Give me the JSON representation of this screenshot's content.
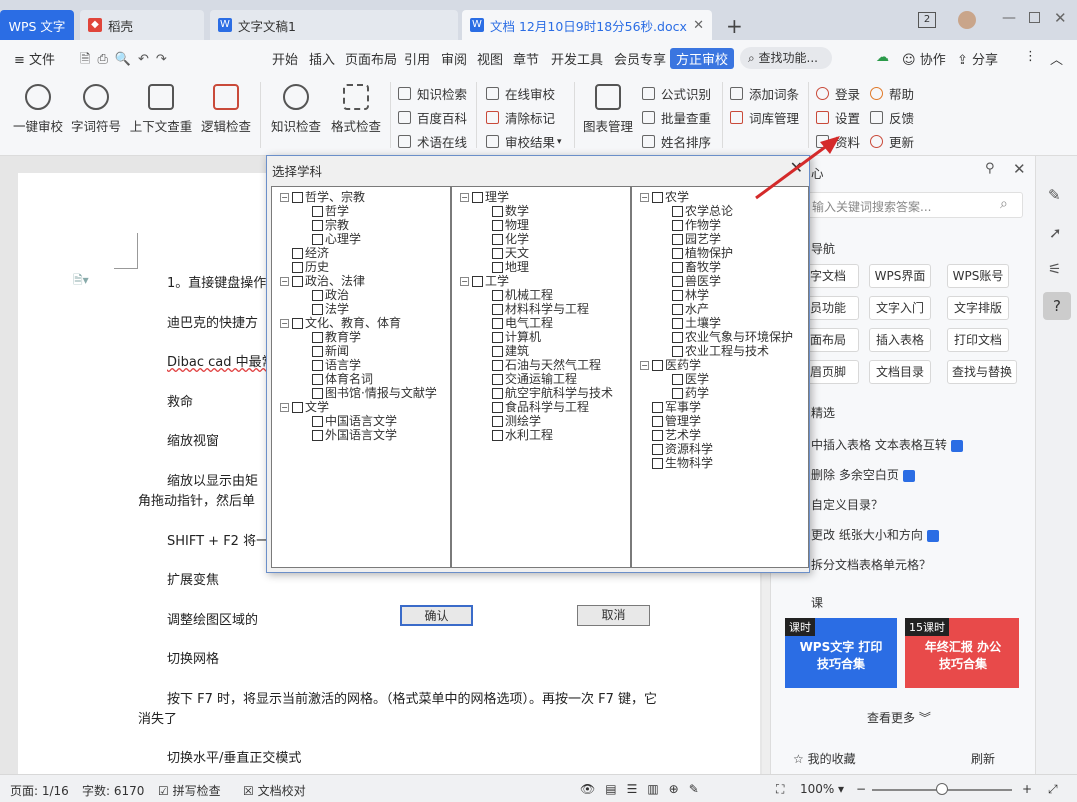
{
  "tabs": [
    {
      "label": "WPS 文字"
    },
    {
      "label": "稻壳"
    },
    {
      "label": "文字文稿1"
    },
    {
      "label": "文档 12月10日9时18分56秒.docx"
    }
  ],
  "window": {
    "badge": "2"
  },
  "menu": {
    "file": "文件",
    "items": [
      "开始",
      "插入",
      "页面布局",
      "引用",
      "审阅",
      "视图",
      "章节",
      "开发工具",
      "会员专享"
    ],
    "active": "方正审校",
    "search": "查找功能...",
    "collab": "协作",
    "share": "分享"
  },
  "ribbon": {
    "big": [
      "一键审校",
      "字词符号",
      "上下文查重",
      "逻辑检查",
      "知识检查",
      "格式检查",
      "图表管理"
    ],
    "small": {
      "g1": [
        "知识检索",
        "百度百科",
        "术语在线"
      ],
      "g2": [
        "在线审校",
        "清除标记",
        "审校结果"
      ],
      "g3": [
        "公式识别",
        "批量查重",
        "姓名排序"
      ],
      "g4": [
        "添加词条",
        "词库管理"
      ],
      "g5": [
        "登录",
        "设置",
        "资料"
      ],
      "g6": [
        "帮助",
        "反馈",
        "更新"
      ]
    }
  },
  "document": {
    "lines": [
      "1。直接键盘操作",
      "迪巴克的快捷方",
      "Dibac cad 中最常",
      "救命",
      "缩放视窗",
      "缩放以显示由矩",
      "角拖动指针，然后单",
      "SHIFT + F2 将一次",
      "扩展变焦",
      "调整绘图区域的",
      "切换网格",
      "按下 F7 时，将显示当前激活的网格。（格式菜单中的网格选项）。再按一次 F7 键，它",
      "消失了",
      "切换水平/垂直正交模式"
    ]
  },
  "rightpanel": {
    "header": "心",
    "search_placeholder": "输入关键词搜索答案...",
    "nav_title": "导航",
    "buttons": [
      "字文档",
      "WPS界面",
      "WPS账号",
      "员功能",
      "文字入门",
      "文字排版",
      "面布局",
      "插入表格",
      "打印文档",
      "眉页脚",
      "文档目录",
      "查找与替换"
    ],
    "picks_title": "精选",
    "picks": [
      "中插入表格 文本表格互转",
      "删除 多余空白页",
      "自定义目录？",
      "更改 纸张大小和方向",
      "拆分文档表格单元格？"
    ],
    "course_title": "课",
    "courses": [
      {
        "badge": "课时",
        "title": "WPS文字 打印技巧合集"
      },
      {
        "badge": "15课时",
        "title": "年终汇报 办公技巧合集"
      }
    ],
    "more": "查看更多",
    "favorites": "我的收藏",
    "refresh": "刷新"
  },
  "dialog": {
    "title": "选择学科",
    "ok": "确认",
    "cancel": "取消",
    "col1": [
      {
        "t": "哲学、宗教",
        "lv": 0
      },
      {
        "t": "哲学",
        "lv": 1
      },
      {
        "t": "宗教",
        "lv": 1
      },
      {
        "t": "心理学",
        "lv": 1
      },
      {
        "t": "经济",
        "lv": 0
      },
      {
        "t": "历史",
        "lv": 0
      },
      {
        "t": "政治、法律",
        "lv": 0
      },
      {
        "t": "政治",
        "lv": 1
      },
      {
        "t": "法学",
        "lv": 1
      },
      {
        "t": "文化、教育、体育",
        "lv": 0
      },
      {
        "t": "教育学",
        "lv": 1
      },
      {
        "t": "新闻",
        "lv": 1
      },
      {
        "t": "语言学",
        "lv": 1
      },
      {
        "t": "体育名词",
        "lv": 1
      },
      {
        "t": "图书馆·情报与文献学",
        "lv": 1
      },
      {
        "t": "文学",
        "lv": 0
      },
      {
        "t": "中国语言文学",
        "lv": 1
      },
      {
        "t": "外国语言文学",
        "lv": 1
      }
    ],
    "col2": [
      {
        "t": "理学",
        "lv": 0
      },
      {
        "t": "数学",
        "lv": 1
      },
      {
        "t": "物理",
        "lv": 1
      },
      {
        "t": "化学",
        "lv": 1
      },
      {
        "t": "天文",
        "lv": 1
      },
      {
        "t": "地理",
        "lv": 1
      },
      {
        "t": "工学",
        "lv": 0
      },
      {
        "t": "机械工程",
        "lv": 1
      },
      {
        "t": "材料科学与工程",
        "lv": 1
      },
      {
        "t": "电气工程",
        "lv": 1
      },
      {
        "t": "计算机",
        "lv": 1
      },
      {
        "t": "建筑",
        "lv": 1
      },
      {
        "t": "石油与天然气工程",
        "lv": 1
      },
      {
        "t": "交通运输工程",
        "lv": 1
      },
      {
        "t": "航空宇航科学与技术",
        "lv": 1
      },
      {
        "t": "食品科学与工程",
        "lv": 1
      },
      {
        "t": "测绘学",
        "lv": 1
      },
      {
        "t": "水利工程",
        "lv": 1
      }
    ],
    "col3": [
      {
        "t": "农学",
        "lv": 0
      },
      {
        "t": "农学总论",
        "lv": 1
      },
      {
        "t": "作物学",
        "lv": 1
      },
      {
        "t": "园艺学",
        "lv": 1
      },
      {
        "t": "植物保护",
        "lv": 1
      },
      {
        "t": "畜牧学",
        "lv": 1
      },
      {
        "t": "兽医学",
        "lv": 1
      },
      {
        "t": "林学",
        "lv": 1
      },
      {
        "t": "水产",
        "lv": 1
      },
      {
        "t": "土壤学",
        "lv": 1
      },
      {
        "t": "农业气象与环境保护",
        "lv": 1
      },
      {
        "t": "农业工程与技术",
        "lv": 1
      },
      {
        "t": "医药学",
        "lv": 0
      },
      {
        "t": "医学",
        "lv": 1
      },
      {
        "t": "药学",
        "lv": 1
      },
      {
        "t": "军事学",
        "lv": 0
      },
      {
        "t": "管理学",
        "lv": 0
      },
      {
        "t": "艺术学",
        "lv": 0
      },
      {
        "t": "资源科学",
        "lv": 0
      },
      {
        "t": "生物科学",
        "lv": 0
      }
    ]
  },
  "status": {
    "page": "页面: 1/16",
    "words": "字数: 6170",
    "spell": "拼写检查",
    "proof": "文档校对",
    "zoom": "100%"
  },
  "colors": {
    "accent": "#2b6de4",
    "arrow": "#d42a2a",
    "dialog_border": "#6b8fc9"
  }
}
